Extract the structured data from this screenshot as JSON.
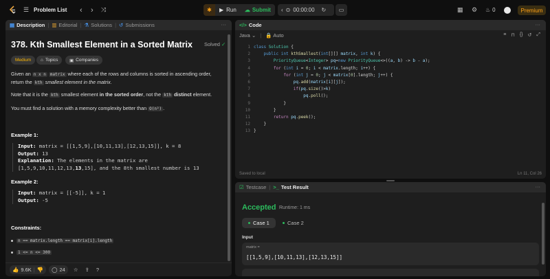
{
  "topbar": {
    "title": "Problem List",
    "run_label": "Run",
    "submit_label": "Submit",
    "timer": "00:00:00",
    "streak": "0",
    "premium_label": "Premium"
  },
  "desc_tabs": [
    "Description",
    "Editorial",
    "Solutions",
    "Submissions"
  ],
  "problem": {
    "title": "378. Kth Smallest Element in a Sorted Matrix",
    "status": "Solved",
    "difficulty": "Medium",
    "chip_topics": "Topics",
    "chip_companies": "Companies",
    "p1_a": "Given an ",
    "p1_code": "n x n",
    "p1_b": " ",
    "p1_code2": "matrix",
    "p1_c": " where each of the rows and columns is sorted in ascending order,",
    "p1_d": "return the ",
    "p1_sup": "kth",
    "p1_e": " smallest element in the matrix.",
    "p2_a": "Note that it is the ",
    "p2_sup": "kth",
    "p2_b": " smallest element ",
    "p2_bold": "in the sorted order",
    "p2_c": ", not the ",
    "p2_sup2": "kth",
    "p2_d": " distinct",
    "p2_e": " element.",
    "p3_a": "You must find a solution with a memory complexity better than ",
    "p3_code": "O(n²)",
    "p3_b": ".",
    "ex1_heading": "Example 1:",
    "ex1_l1_k": "Input:",
    "ex1_l1_v": " matrix = [[1,5,9],[10,11,13],[12,13,15]], k = 8",
    "ex1_l2_k": "Output:",
    "ex1_l2_v": " 13",
    "ex1_l3_k": "Explanation:",
    "ex1_l3_v": " The elements in the matrix are",
    "ex1_l4_a": "[1,5,9,10,11,12,13,",
    "ex1_l4_b": "13",
    "ex1_l4_c": ",15], and the 8th smallest number is 13",
    "ex2_heading": "Example 2:",
    "ex2_l1_k": "Input:",
    "ex2_l1_v": " matrix = [[-5]], k = 1",
    "ex2_l2_k": "Output:",
    "ex2_l2_v": " -5",
    "constraints_heading": "Constraints:",
    "c1": "n == matrix.length == matrix[i].length",
    "c2": "1 <= n <= 300",
    "likes": "9.6K",
    "comments": "24"
  },
  "code_panel": {
    "title": "Code",
    "language": "Java",
    "mode": "Auto",
    "saved": "Saved to local",
    "cursor": "Ln 11, Col 26",
    "line_numbers": [
      "1",
      "2",
      "3",
      "4",
      "5",
      "6",
      "7",
      "8",
      "9",
      "10",
      "11",
      "12",
      "13"
    ]
  },
  "test_panel": {
    "tab_testcase": "Testcase",
    "tab_result": "Test Result",
    "accepted": "Accepted",
    "runtime": "Runtime: 1 ms",
    "case1": "Case 1",
    "case2": "Case 2",
    "input_label": "Input",
    "var_name": "matrix =",
    "var_value": "[[1,5,9],[10,11,13],[12,13,15]]"
  }
}
